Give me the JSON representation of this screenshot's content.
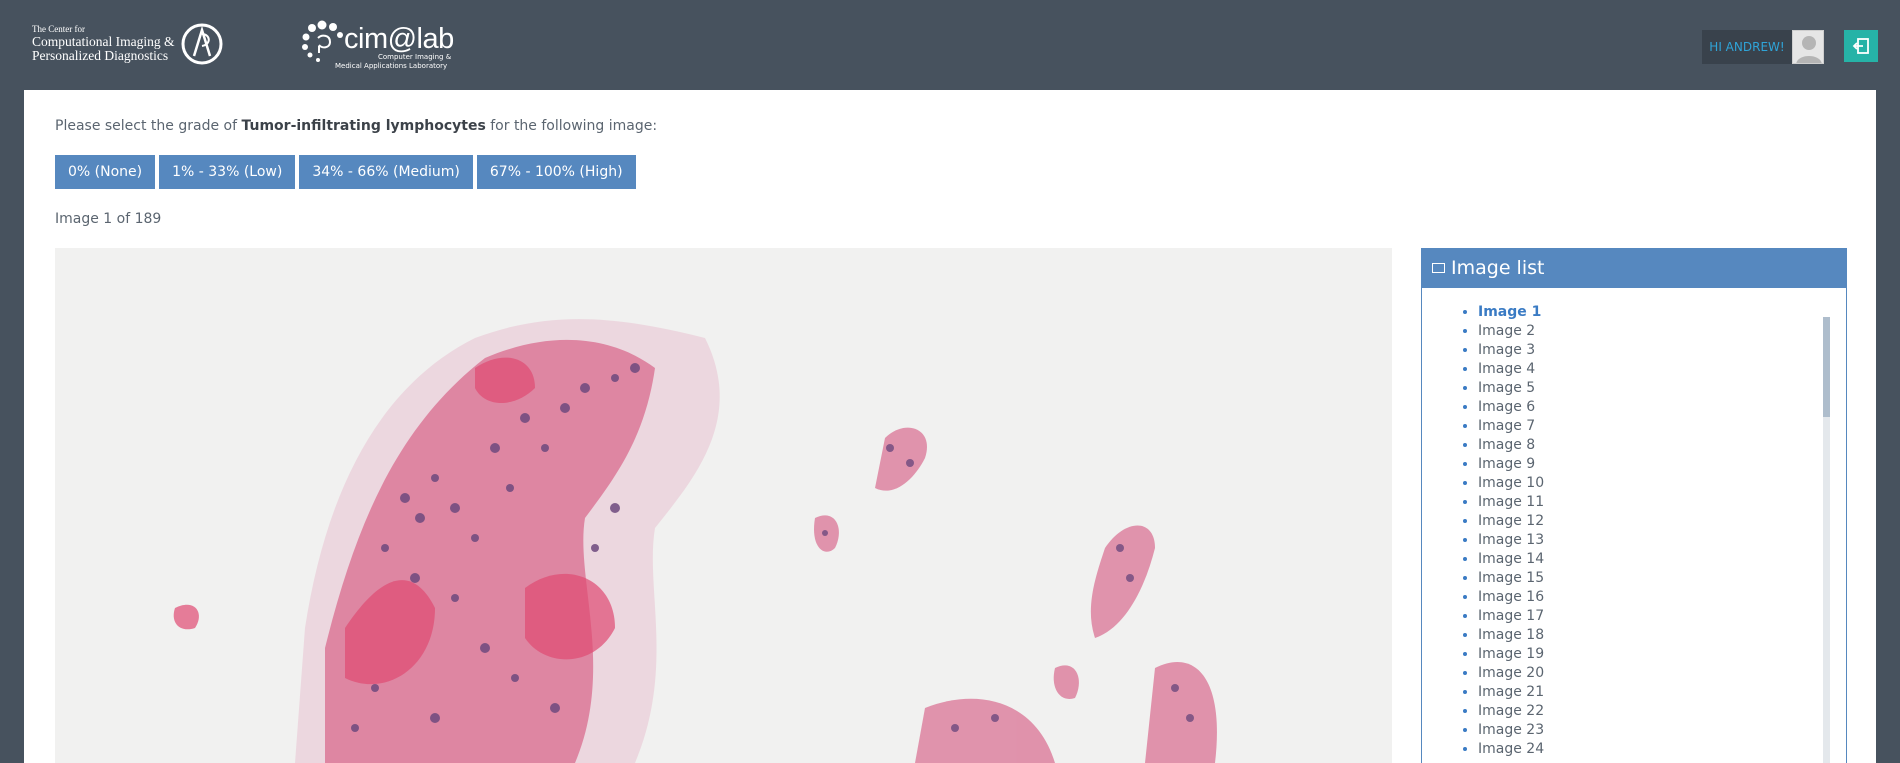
{
  "header": {
    "logo_cipd": {
      "line1": "The Center for",
      "line2": "Computational Imaging &",
      "line3": "Personalized Diagnostics"
    },
    "logo_cim": {
      "word": "cim@lab",
      "sub1": "Computer Imaging &",
      "sub2": "Medical Applications Laboratory"
    },
    "greeting": "HI ANDREW!",
    "logout_icon": "logout-icon"
  },
  "main": {
    "prompt_before": "Please select the grade of ",
    "prompt_bold": "Tumor-infiltrating lymphocytes",
    "prompt_after": " for the following image:",
    "grades": [
      "0% (None)",
      "1% - 33% (Low)",
      "34% - 66% (Medium)",
      "67% - 100% (High)"
    ],
    "counter": "Image 1 of 189"
  },
  "image_list": {
    "title": "Image list",
    "items": [
      "Image 1",
      "Image 2",
      "Image 3",
      "Image 4",
      "Image 5",
      "Image 6",
      "Image 7",
      "Image 8",
      "Image 9",
      "Image 10",
      "Image 11",
      "Image 12",
      "Image 13",
      "Image 14",
      "Image 15",
      "Image 16",
      "Image 17",
      "Image 18",
      "Image 19",
      "Image 20",
      "Image 21",
      "Image 22",
      "Image 23",
      "Image 24"
    ],
    "active_index": 0
  },
  "colors": {
    "header_bg": "#47525e",
    "grade_button": "#5688bf",
    "logout_button": "#26b3a7",
    "greeting_text": "#2fa4d8"
  }
}
